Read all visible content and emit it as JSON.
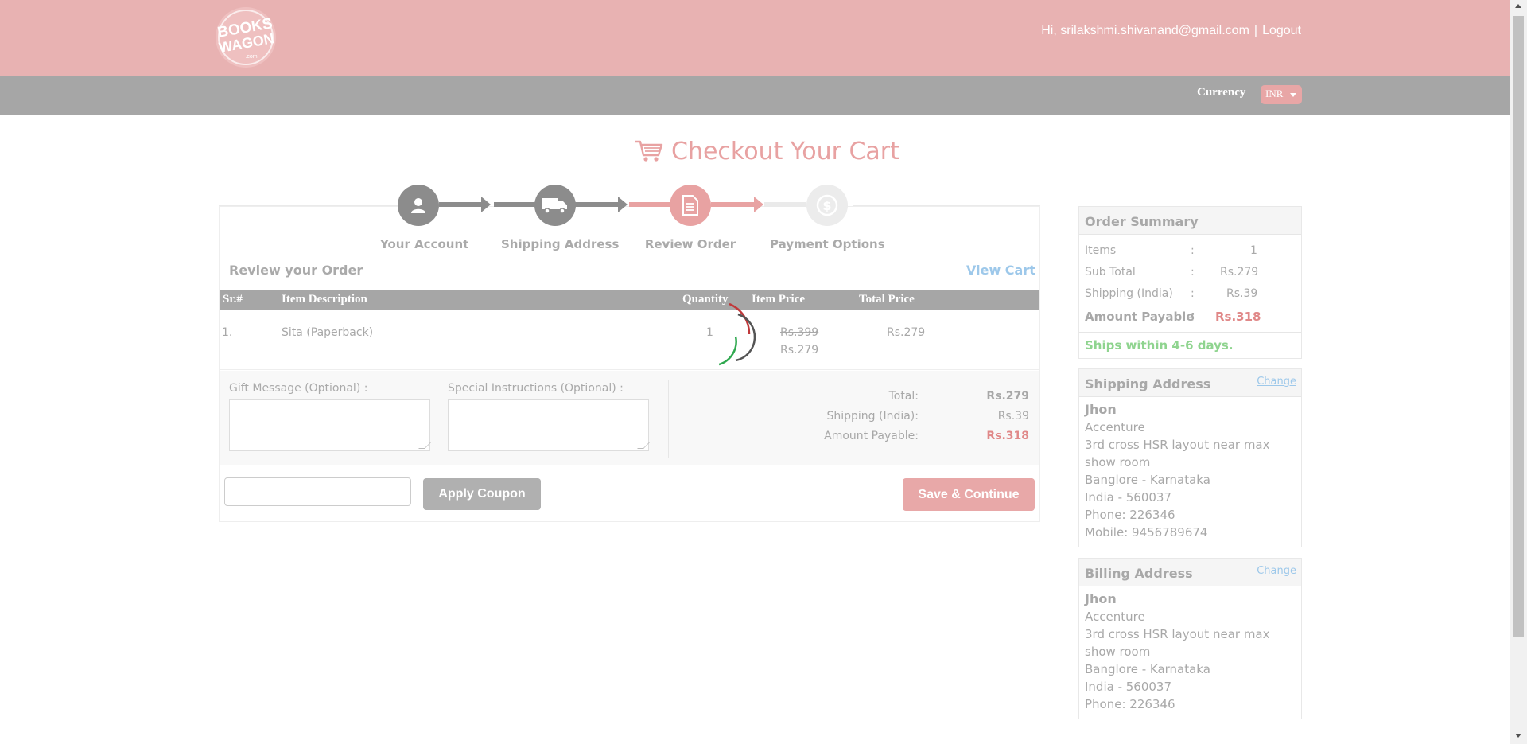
{
  "header": {
    "logo_text_1": "BOOKS",
    "logo_text_2": "WAGON",
    "logo_text_3": ".com",
    "greeting": "Hi, srilakshmi.shivanand@gmail.com",
    "separator": "|",
    "logout": "Logout"
  },
  "currency": {
    "label": "Currency",
    "selected": "INR"
  },
  "title": "Checkout Your Cart",
  "steps": [
    {
      "label": "Your Account",
      "icon": "user-icon"
    },
    {
      "label": "Shipping Address",
      "icon": "truck-icon"
    },
    {
      "label": "Review Order",
      "icon": "document-icon"
    },
    {
      "label": "Payment Options",
      "icon": "dollar-icon"
    }
  ],
  "review": {
    "title": "Review your Order",
    "view_cart": "View Cart",
    "columns": [
      "Sr.#",
      "Item Description",
      "Quantity",
      "Item Price",
      "Total Price"
    ],
    "rows": [
      {
        "sr": "1.",
        "description": "Sita (Paperback)",
        "quantity": "1",
        "old_price": "Rs.399",
        "price": "Rs.279",
        "total": "Rs.279"
      }
    ],
    "gift_label": "Gift Message (Optional) :",
    "instructions_label": "Special Instructions (Optional) :",
    "totals": {
      "total_label": "Total:",
      "total_value": "Rs.279",
      "shipping_label": "Shipping (India):",
      "shipping_value": "Rs.39",
      "payable_label": "Amount Payable:",
      "payable_value": "Rs.318"
    },
    "apply_coupon": "Apply Coupon",
    "save_continue": "Save & Continue"
  },
  "summary": {
    "title": "Order Summary",
    "rows": [
      {
        "label": "Items",
        "colon": ":",
        "value": "1"
      },
      {
        "label": "Sub Total",
        "colon": ":",
        "value": "Rs.279"
      },
      {
        "label": "Shipping (India)",
        "colon": ":",
        "value": "Rs.39"
      },
      {
        "label": "Amount Payable",
        "colon": ":",
        "value": "Rs.318"
      }
    ],
    "ships": "Ships within 4-6 days."
  },
  "shipping_address": {
    "title": "Shipping Address",
    "change": "Change",
    "name": "Jhon",
    "lines": [
      "Accenture",
      "3rd cross HSR layout near max show room",
      "Banglore - Karnataka",
      "India - 560037",
      "Phone: 226346",
      "Mobile: 9456789674"
    ]
  },
  "billing_address": {
    "title": "Billing Address",
    "change": "Change",
    "name": "Jhon",
    "lines": [
      "Accenture",
      "3rd cross HSR layout near max show room",
      "Banglore - Karnataka",
      "India - 560037",
      "Phone: 226346"
    ]
  },
  "colors": {
    "header_bg": "#e8b2b2",
    "bar_bg": "#a6a6a6",
    "accent": "#e8a2a2",
    "link": "#9dc8ea",
    "green": "#8fd48f"
  }
}
